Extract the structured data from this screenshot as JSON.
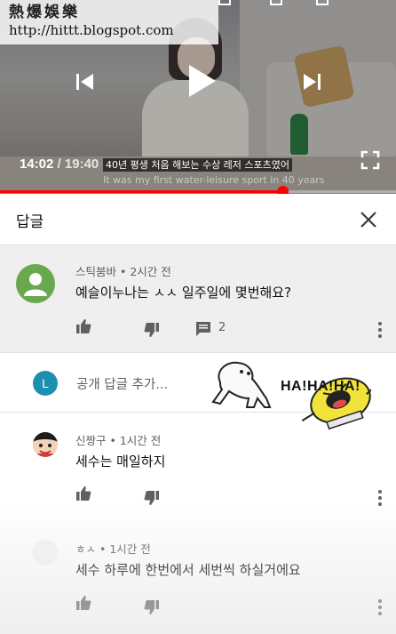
{
  "watermark": {
    "title": "熱爆娛樂",
    "url": "http://hittt.blogspot.com"
  },
  "player": {
    "current_time": "14:02",
    "duration": "19:40",
    "time_separator": " / ",
    "caption_korean": "40년 평생 처음 해보는 수상 레저 스포츠였어",
    "caption_english": "It was my first water-leisure sport in 40 years",
    "progress_fraction": 0.713,
    "accent_color": "#ff0000"
  },
  "panel": {
    "title": "답글"
  },
  "parent_comment": {
    "author": "스틱붐바",
    "time": "2시간 전",
    "text": "예슬이누나는 ㅅㅅ 일주일에 몇번해요?",
    "reply_count": "2"
  },
  "add_reply": {
    "avatar_letter": "L",
    "placeholder": "공개 답글 추가..."
  },
  "sticker": {
    "text": "HA!HA!HA!"
  },
  "replies": [
    {
      "author": "신짱구",
      "time": "1시간 전",
      "text": "세수는 매일하지"
    },
    {
      "author": "ㅎㅅ",
      "time": "1시간 전",
      "text": "세수 하루에 한번에서 세번씩 하실거에요"
    }
  ],
  "meta_separator": " • "
}
